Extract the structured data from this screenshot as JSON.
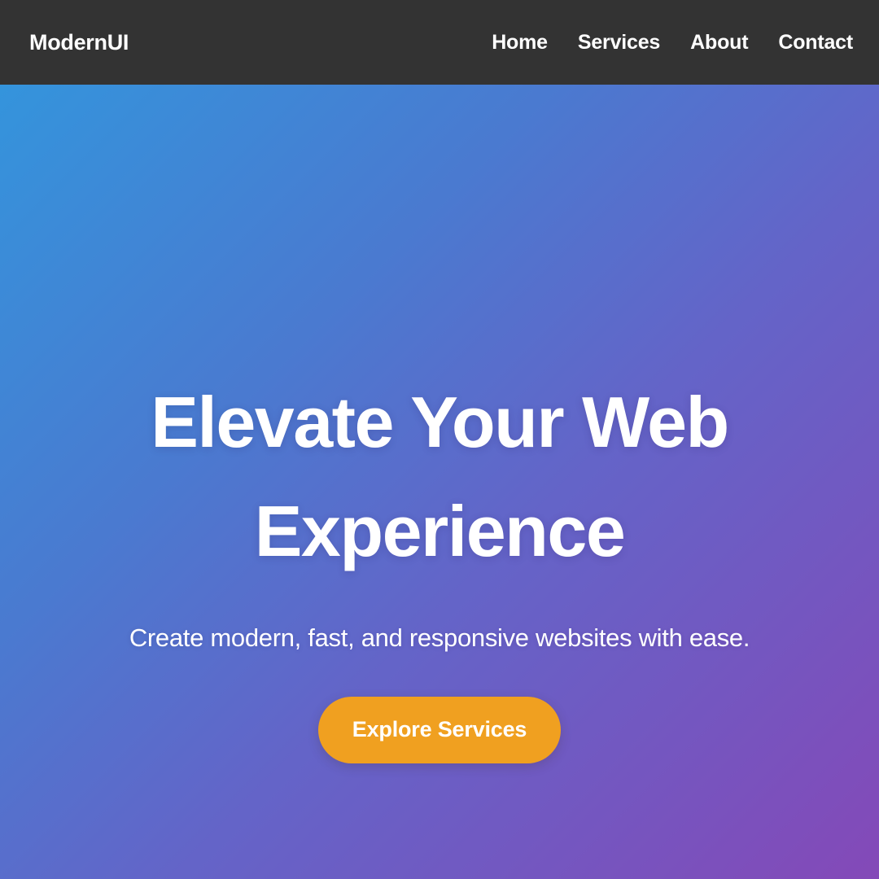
{
  "header": {
    "brand": "ModernUI",
    "nav": [
      {
        "label": "Home",
        "name": "nav-link-home"
      },
      {
        "label": "Services",
        "name": "nav-link-services"
      },
      {
        "label": "About",
        "name": "nav-link-about"
      },
      {
        "label": "Contact",
        "name": "nav-link-contact"
      }
    ],
    "background_color": "#333333",
    "text_color": "#ffffff"
  },
  "hero": {
    "title_line_1": "Elevate Your Web",
    "title_line_2": "Experience",
    "subtitle": "Create modern, fast, and responsive websites with ease.",
    "cta_label": "Explore Services",
    "gradient_start_color": "#3494dc",
    "gradient_end_color": "#8449b8",
    "cta_color": "#f0a020",
    "text_color": "#ffffff"
  }
}
